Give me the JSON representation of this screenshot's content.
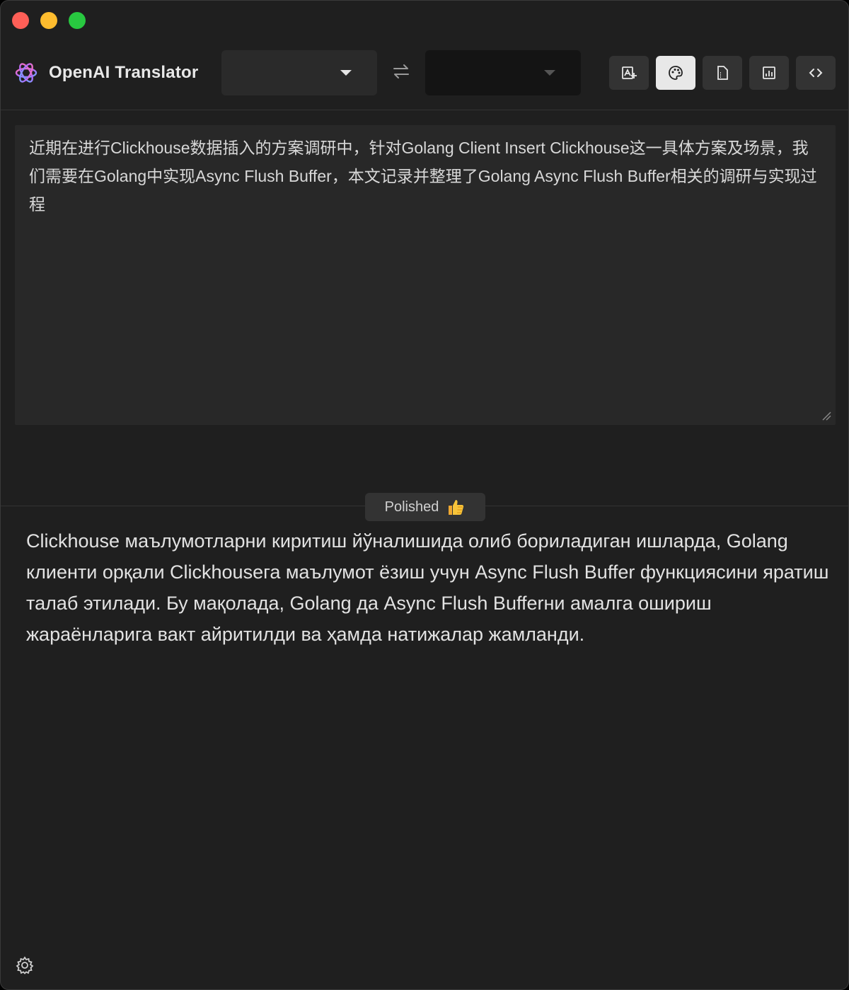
{
  "window": {
    "title": "OpenAI Translator"
  },
  "header": {
    "from_language": "",
    "to_language": ""
  },
  "toolbar": {
    "buttons": [
      "image-translate-icon",
      "palette-icon",
      "document-icon",
      "chart-icon",
      "code-icon"
    ],
    "active_index": 1
  },
  "source": {
    "text": "近期在进行Clickhouse数据插入的方案调研中，针对Golang Client Insert Clickhouse这一具体方案及场景，我们需要在Golang中实现Async Flush Buffer，本文记录并整理了Golang Async Flush Buffer相关的调研与实现过程"
  },
  "result": {
    "mode_label": "Polished",
    "text": "Clickhouse маълумотларни киритиш йўналишида олиб бориладиган ишларда, Golang клиенти орқали Clickhouseга маълумот ёзиш учун Async Flush Buffer функциясини яратиш талаб этилади. Бу мақолада, Golang да Async Flush Bufferни амалга ошириш жараёнларига вакт айритилди ва ҳамда натижалар жамланди."
  },
  "colors": {
    "background": "#1f1f1f",
    "input_bg": "#282828",
    "button_bg": "#333333",
    "button_active": "#e8e8e8",
    "text": "#e2e2e2"
  }
}
